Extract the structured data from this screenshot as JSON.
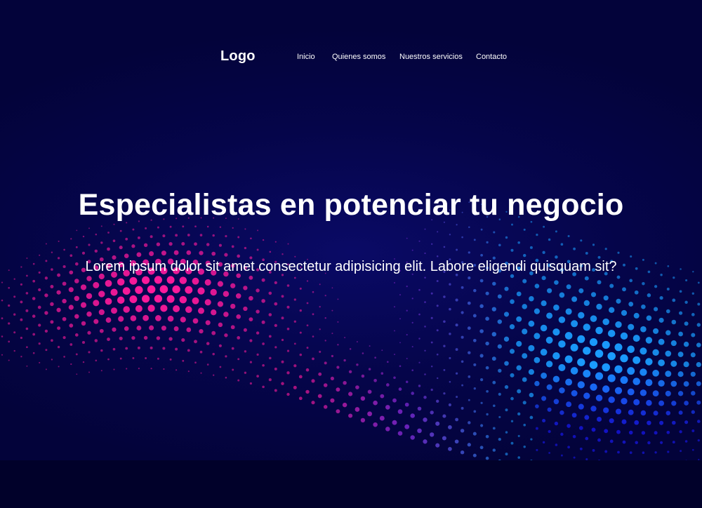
{
  "nav": {
    "logo": "Logo",
    "items": [
      {
        "label": "Inicio"
      },
      {
        "label": "Quienes somos"
      },
      {
        "label": "Nuestros servicios"
      },
      {
        "label": "Contacto"
      }
    ]
  },
  "hero": {
    "title": "Especialistas en potenciar tu negocio",
    "subtitle": "Lorem ipsum dolor sit amet consectetur adipisicing elit. Labore eligendi quisquam sit?"
  },
  "colors": {
    "background": "#03033a",
    "footer": "#01012a",
    "dot_pink": "#ff1a9c",
    "dot_purple": "#8a2be2",
    "dot_blue": "#1a9cff",
    "dot_deep_blue": "#1a1aff",
    "text": "#ffffff"
  }
}
